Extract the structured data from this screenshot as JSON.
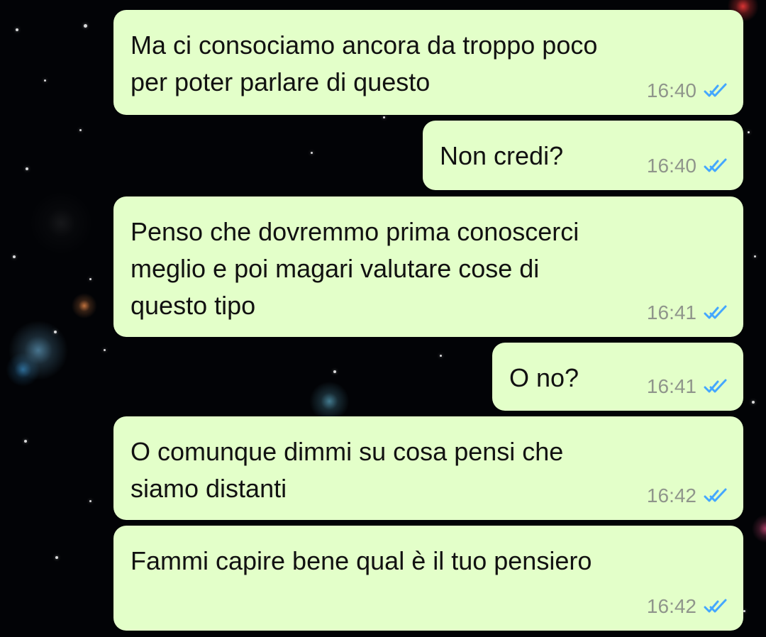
{
  "chat": {
    "messages": [
      {
        "text": "Ma ci consociamo ancora da troppo poco\nper poter parlare di questo",
        "time": "16:40",
        "status_icon": "double-check-icon"
      },
      {
        "text": "Non credi?",
        "time": "16:40",
        "status_icon": "double-check-icon"
      },
      {
        "text": "Penso che dovremmo prima conoscerci\nmeglio e poi magari valutare cose di\nquesto tipo",
        "time": "16:41",
        "status_icon": "double-check-icon"
      },
      {
        "text": "O no?",
        "time": "16:41",
        "status_icon": "double-check-icon"
      },
      {
        "text": "O comunque dimmi su cosa pensi che\nsiamo distanti",
        "time": "16:42",
        "status_icon": "double-check-icon"
      },
      {
        "text": "Fammi capire bene qual è il tuo pensiero",
        "time": "16:42",
        "status_icon": "double-check-icon"
      }
    ]
  },
  "colors": {
    "bubble_background": "#e3ffc9",
    "message_text": "#111111",
    "time_text": "#8f958b",
    "read_tick": "#44a7ff",
    "chat_background": "#020306"
  }
}
